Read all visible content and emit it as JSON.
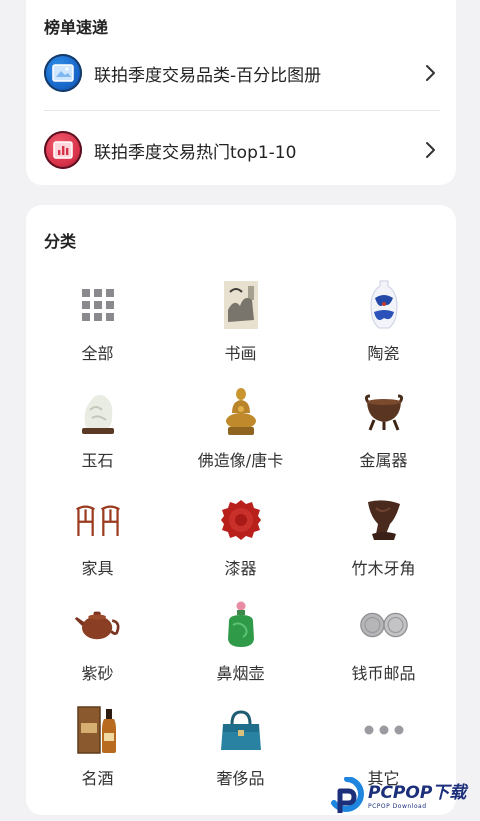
{
  "rankings": {
    "title": "榜单速递",
    "items": [
      {
        "label": "联拍季度交易品类-百分比图册",
        "icon": "image-album-icon"
      },
      {
        "label": "联拍季度交易热门top1-10",
        "icon": "bar-chart-icon"
      }
    ]
  },
  "categories": {
    "title": "分类",
    "items": [
      {
        "label": "全部",
        "icon": "grid-icon"
      },
      {
        "label": "书画",
        "icon": "painting-icon"
      },
      {
        "label": "陶瓷",
        "icon": "porcelain-vase-icon"
      },
      {
        "label": "玉石",
        "icon": "jade-carving-icon"
      },
      {
        "label": "佛造像/唐卡",
        "icon": "buddha-statue-icon"
      },
      {
        "label": "金属器",
        "icon": "bronze-censer-icon"
      },
      {
        "label": "家具",
        "icon": "chairs-icon"
      },
      {
        "label": "漆器",
        "icon": "lacquer-plate-icon"
      },
      {
        "label": "竹木牙角",
        "icon": "carved-cup-icon"
      },
      {
        "label": "紫砂",
        "icon": "teapot-icon"
      },
      {
        "label": "鼻烟壶",
        "icon": "snuff-bottle-icon"
      },
      {
        "label": "钱币邮品",
        "icon": "coins-icon"
      },
      {
        "label": "名酒",
        "icon": "liquor-bottle-icon"
      },
      {
        "label": "奢侈品",
        "icon": "handbag-icon"
      },
      {
        "label": "其它",
        "icon": "more-dots-icon"
      }
    ]
  },
  "watermark": {
    "brand": "PCPOP下载",
    "sub": "PCPOP Download",
    "icon": "pcpop-logo-icon"
  },
  "colors": {
    "background": "#f2f2f4",
    "card": "#ffffff",
    "text": "#222222",
    "divider": "#e6e6e8"
  }
}
